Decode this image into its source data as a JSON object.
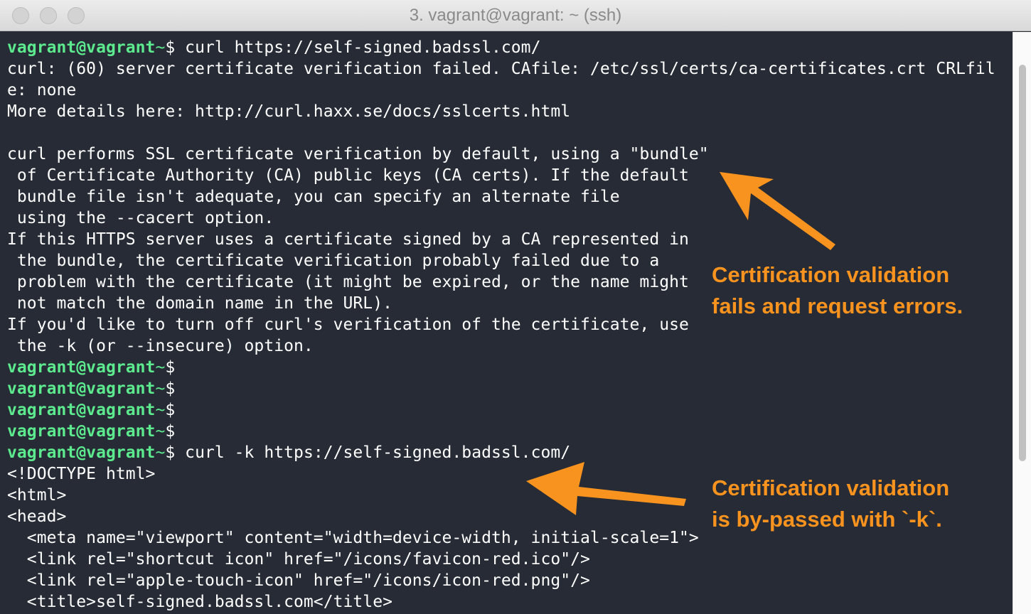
{
  "window": {
    "title": "3. vagrant@vagrant: ~ (ssh)"
  },
  "terminal": {
    "lines": [
      {
        "kind": "prompt",
        "user": "vagrant@vagrant",
        "cwd": "~$",
        "cmd": " curl https://self-signed.badssl.com/"
      },
      {
        "kind": "out",
        "text": "curl: (60) server certificate verification failed. CAfile: /etc/ssl/certs/ca-certificates.crt CRLfil"
      },
      {
        "kind": "out",
        "text": "e: none"
      },
      {
        "kind": "out",
        "text": "More details here: http://curl.haxx.se/docs/sslcerts.html"
      },
      {
        "kind": "out",
        "text": ""
      },
      {
        "kind": "out",
        "text": "curl performs SSL certificate verification by default, using a \"bundle\""
      },
      {
        "kind": "out",
        "text": " of Certificate Authority (CA) public keys (CA certs). If the default"
      },
      {
        "kind": "out",
        "text": " bundle file isn't adequate, you can specify an alternate file"
      },
      {
        "kind": "out",
        "text": " using the --cacert option."
      },
      {
        "kind": "out",
        "text": "If this HTTPS server uses a certificate signed by a CA represented in"
      },
      {
        "kind": "out",
        "text": " the bundle, the certificate verification probably failed due to a"
      },
      {
        "kind": "out",
        "text": " problem with the certificate (it might be expired, or the name might"
      },
      {
        "kind": "out",
        "text": " not match the domain name in the URL)."
      },
      {
        "kind": "out",
        "text": "If you'd like to turn off curl's verification of the certificate, use"
      },
      {
        "kind": "out",
        "text": " the -k (or --insecure) option."
      },
      {
        "kind": "prompt",
        "user": "vagrant@vagrant",
        "cwd": "~$",
        "cmd": ""
      },
      {
        "kind": "prompt",
        "user": "vagrant@vagrant",
        "cwd": "~$",
        "cmd": ""
      },
      {
        "kind": "prompt",
        "user": "vagrant@vagrant",
        "cwd": "~$",
        "cmd": ""
      },
      {
        "kind": "prompt",
        "user": "vagrant@vagrant",
        "cwd": "~$",
        "cmd": ""
      },
      {
        "kind": "prompt",
        "user": "vagrant@vagrant",
        "cwd": "~$",
        "cmd": " curl -k https://self-signed.badssl.com/"
      },
      {
        "kind": "out",
        "text": "<!DOCTYPE html>"
      },
      {
        "kind": "out",
        "text": "<html>"
      },
      {
        "kind": "out",
        "text": "<head>"
      },
      {
        "kind": "out",
        "text": "  <meta name=\"viewport\" content=\"width=device-width, initial-scale=1\">"
      },
      {
        "kind": "out",
        "text": "  <link rel=\"shortcut icon\" href=\"/icons/favicon-red.ico\"/>"
      },
      {
        "kind": "out",
        "text": "  <link rel=\"apple-touch-icon\" href=\"/icons/icon-red.png\"/>"
      },
      {
        "kind": "out",
        "text": "  <title>self-signed.badssl.com</title>"
      }
    ]
  },
  "annotations": {
    "top": "Certification validation\nfails and request errors.",
    "bottom": "Certification validation\nis by-passed with `-k`."
  },
  "colors": {
    "background": "#262b35",
    "prompt": "#5dea8f",
    "text": "#ffffff",
    "annotation": "#f7931e"
  },
  "icons": {
    "window_controls": [
      "close-light",
      "minimize-light",
      "zoom-light"
    ],
    "arrows": [
      "arrow-icon",
      "arrow-icon"
    ]
  }
}
